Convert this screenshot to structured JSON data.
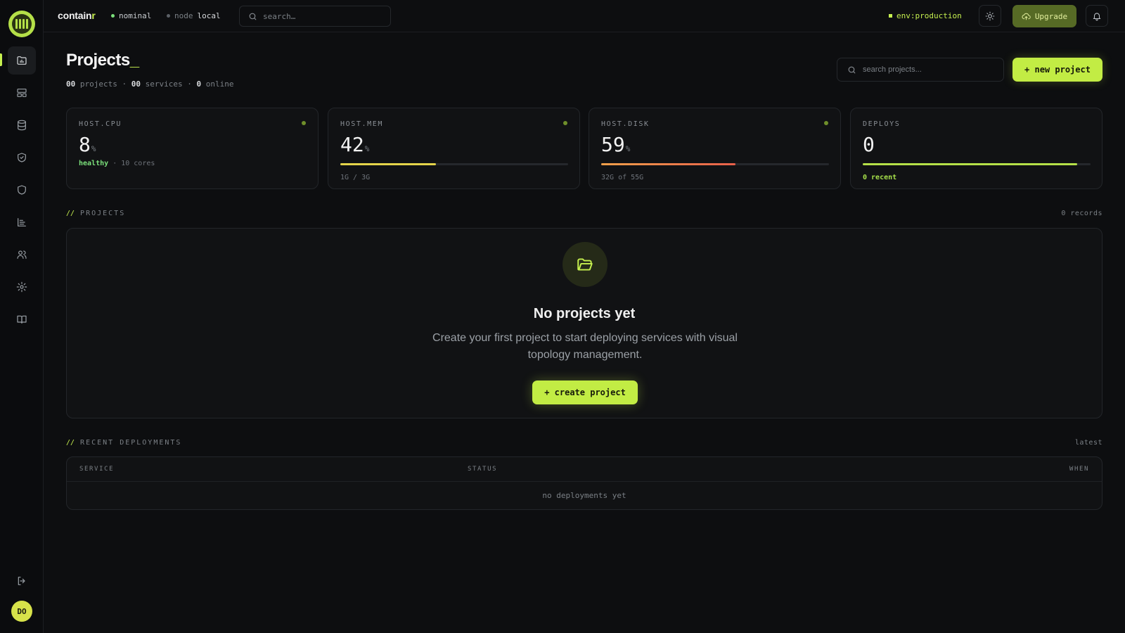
{
  "app": {
    "brand_main": "contain",
    "brand_accent": "r"
  },
  "topbar": {
    "status_label": "nominal",
    "node_prefix": "node",
    "node_value": "local",
    "search_placeholder": "search…",
    "env_label": "env:production",
    "upgrade_label": "Upgrade"
  },
  "sidebar": {
    "items": [
      {
        "name": "projects",
        "icon": "folder-chart-icon"
      },
      {
        "name": "templates",
        "icon": "layout-icon"
      },
      {
        "name": "databases",
        "icon": "database-icon"
      },
      {
        "name": "security",
        "icon": "shield-check-icon"
      },
      {
        "name": "policies",
        "icon": "shield-icon"
      },
      {
        "name": "metrics",
        "icon": "chart-icon"
      },
      {
        "name": "team",
        "icon": "users-icon"
      },
      {
        "name": "settings",
        "icon": "gear-icon"
      },
      {
        "name": "docs",
        "icon": "book-icon"
      }
    ],
    "avatar_initials": "DO"
  },
  "page": {
    "title": "Projects",
    "title_cursor": "_",
    "projects_count": "00",
    "projects_label": "projects",
    "services_count": "00",
    "services_label": "services",
    "online_count": "0",
    "online_label": "online",
    "search_placeholder": "search projects...",
    "new_project_label": "+ new project"
  },
  "stats": [
    {
      "label": "HOST.CPU",
      "value": "8",
      "unit": "%",
      "foot_status": "healthy",
      "foot_text": "· 10 cores"
    },
    {
      "label": "HOST.MEM",
      "value": "42",
      "unit": "%",
      "progress": 0.42,
      "foot_text": "1G / 3G"
    },
    {
      "label": "HOST.DISK",
      "value": "59",
      "unit": "%",
      "progress": 0.59,
      "foot_text": "32G of 55G"
    },
    {
      "label": "DEPLOYS",
      "value": "0",
      "progress": 0.94,
      "foot_text": "0 recent"
    }
  ],
  "projects_section": {
    "slashes": "//",
    "title": "PROJECTS",
    "count_text": "0 records",
    "empty_title": "No projects yet",
    "empty_desc": "Create your first project to start deploying services with visual topology management.",
    "create_label": "+ create project"
  },
  "deployments_section": {
    "slashes": "//",
    "title": "RECENT DEPLOYMENTS",
    "right_text": "latest",
    "columns": [
      "SERVICE",
      "STATUS",
      "WHEN"
    ],
    "empty_text": "no deployments yet"
  },
  "colors": {
    "accent": "#c6f04f",
    "background": "#0d0e10",
    "mem_bar": "#e4d44a",
    "disk_bar_start": "#f0a04a",
    "disk_bar_end": "#e8604a",
    "deploy_bar": "#b5e048"
  }
}
